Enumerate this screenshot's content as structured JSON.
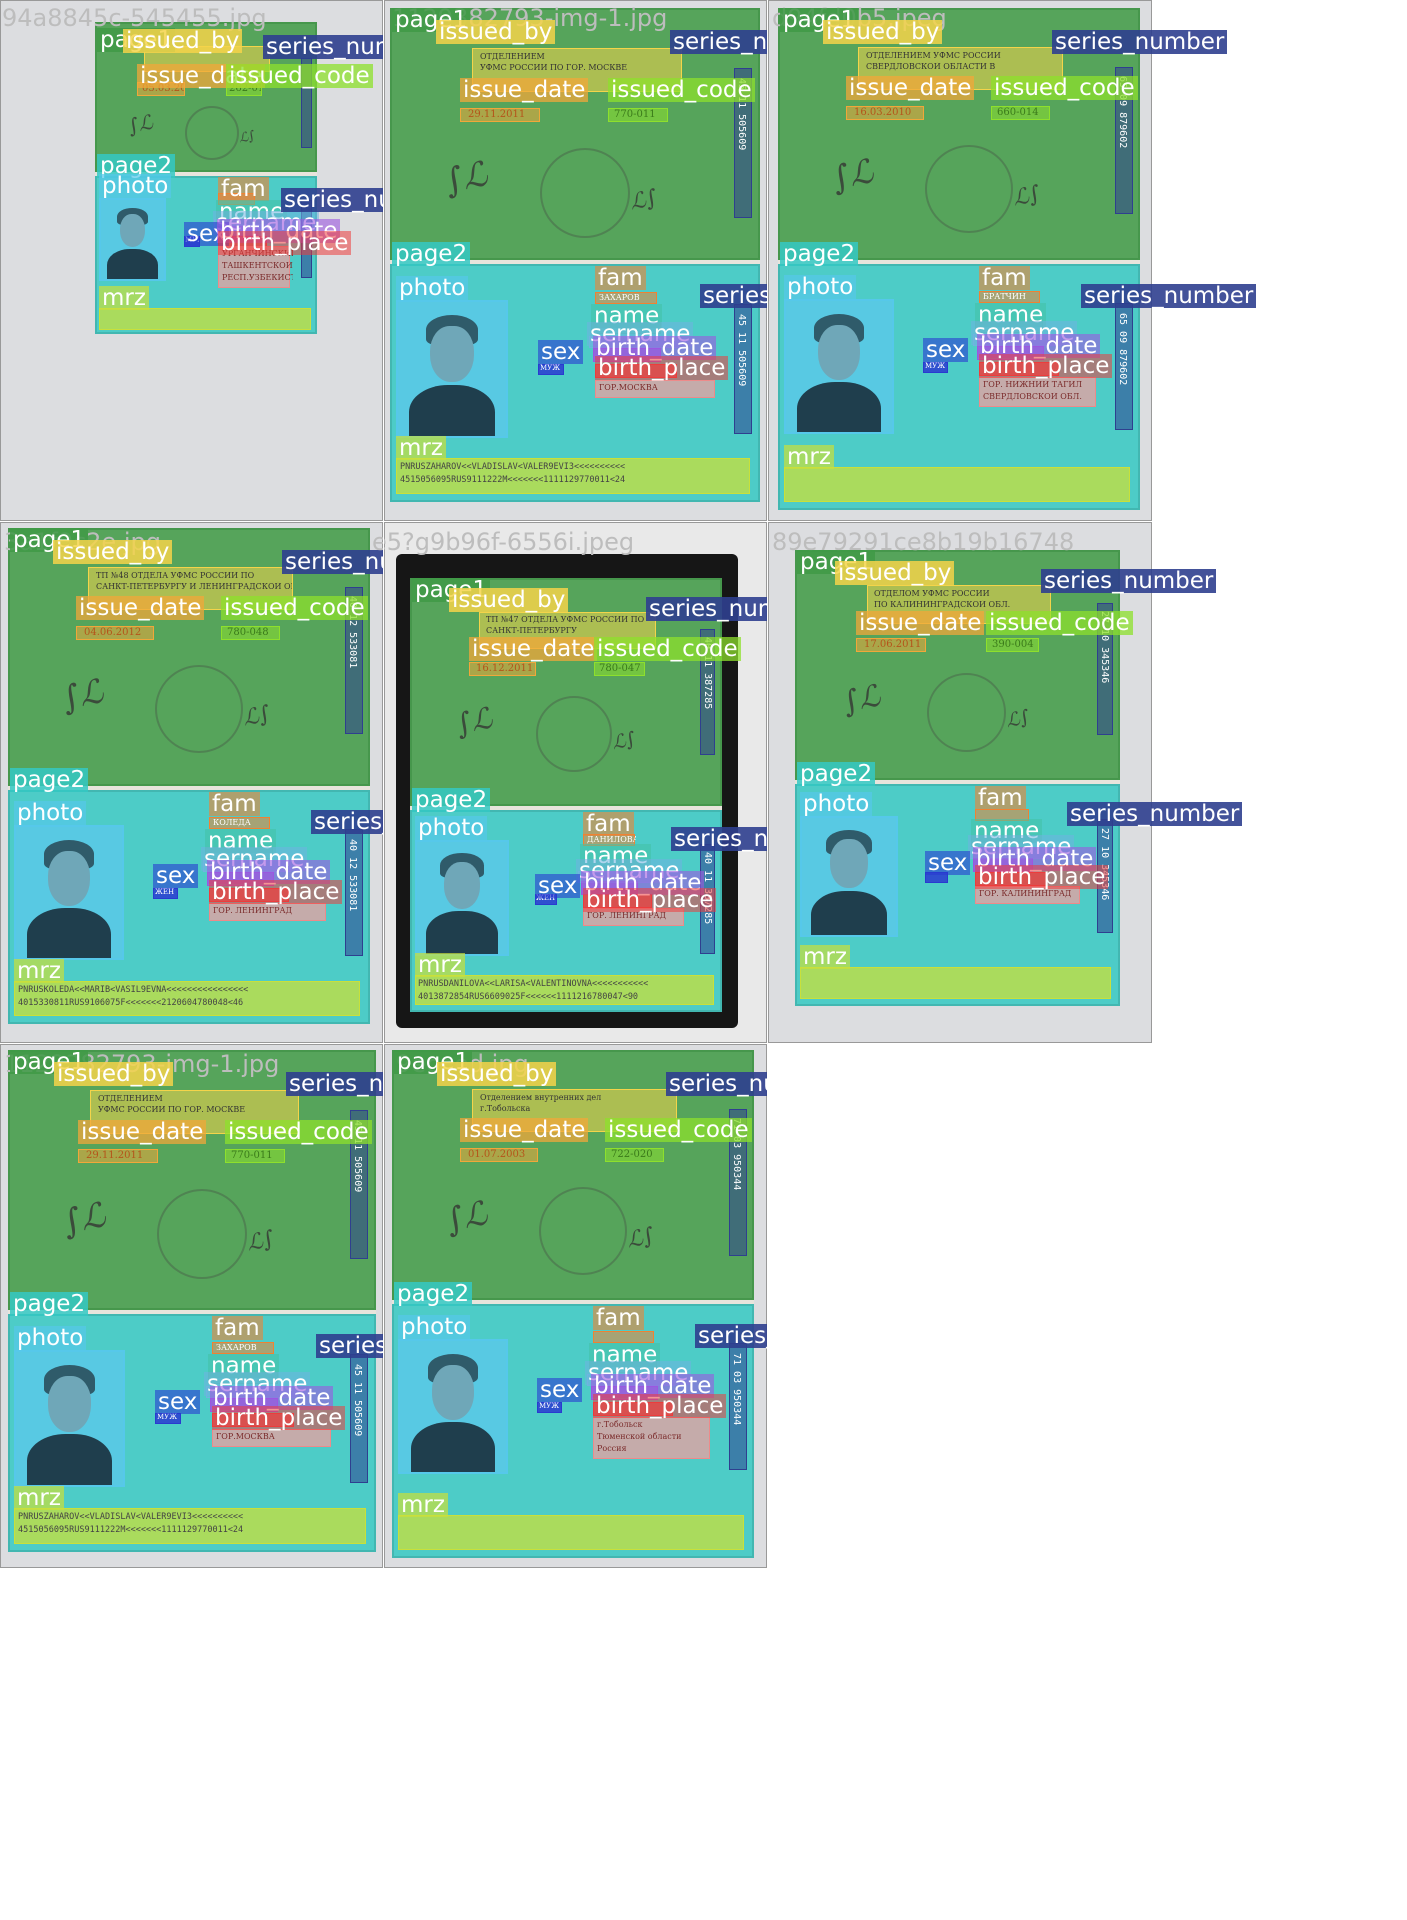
{
  "colors": {
    "page1": "#3f9a47",
    "page2": "#34c9c4",
    "issued_by": "#f4d44a",
    "issue_date": "#f1a73a",
    "issued_code": "#8ee02c",
    "series_number": "#2f3f8f",
    "photo": "#56c8ea",
    "fam": "#f08232",
    "name": "#45c1a6",
    "sername": "#6fb3e0",
    "birth_date": "#9c57e0",
    "birth_place": "#ee3d3d",
    "sex": "#2a3ad0",
    "mrz": "#c9e03a"
  },
  "labels": {
    "page1": "page1",
    "page2": "page2",
    "passport": "passport",
    "issued_by": "issued_by",
    "issue_date": "issue_date",
    "issued_code": "issued_code",
    "series_number": "series_number",
    "photo": "photo",
    "fam": "fam",
    "name": "name",
    "sername": "sername",
    "sex": "sex",
    "birth_date": "birth_date",
    "birth_place": "birth_place",
    "mrz": "mrz",
    "code": "code"
  },
  "cells": [
    {
      "filename": "94a8845c-545455.jpg",
      "issue_date": "05.03.2004",
      "issued_code": "262-015",
      "series_number": "",
      "sex": "МУЖ",
      "birth_place": [
        "УРГАНЧИНСКИЙ Р-Н",
        "ТАШКЕНТСКОЙ ОБЛ.",
        "РЕСП.УЗБЕКИСТАН"
      ],
      "mrz": [
        "",
        ""
      ]
    },
    {
      "filename": "1129382793-img-1.jpg",
      "issued_by": [
        "ОТДЕЛЕНИЕМ",
        "УФМС РОССИИ ПО ГОР. МОСКВЕ"
      ],
      "issue_date": "29.11.2011",
      "issued_code": "770-011",
      "series_number": "45 11 505609",
      "fam": "ЗАХАРОВ",
      "sex": "МУЖ",
      "birth_place": [
        "ГОР.МОСКВА"
      ],
      "mrz": [
        "PNRUSZAHAROV<<VLADISLAV<VALER9EVI3<<<<<<<<<<",
        "4515056095RUS9111222M<<<<<<<1111129770011<24"
      ]
    },
    {
      "filename": "d94fd0b5.jpeg",
      "issued_by": [
        "ОТДЕЛЕНИЕМ УФМС РОССИИ",
        "СВЕРДЛОВСКОЙ ОБЛАСТИ В"
      ],
      "issue_date": "16.03.2010",
      "issued_code": "660-014",
      "series_number": "65 09 879602",
      "fam": "БРАТЧИН",
      "sex": "МУЖ",
      "birth_place": [
        "ГОР. НИЖНИЙ ТАГИЛ",
        "СВЕРДЛОВСКОЙ ОБЛ."
      ],
      "mrz": [
        "",
        ""
      ]
    },
    {
      "filename": "3a1f9c2e.jpg",
      "issued_by": [
        "ТП №48 ОТДЕЛА УФМС РОССИИ ПО",
        "САНКТ-ПЕТЕРБУРГУ И ЛЕНИНГРАДСКОЙ ОБЛ."
      ],
      "issue_date": "04.06.2012",
      "issued_code": "780-048",
      "series_number": "40 12 533081",
      "fam": "КОЛЕДА",
      "sex": "ЖЕН",
      "birth_place": [
        "ГОР. ЛЕНИНГРАД"
      ],
      "mrz": [
        "PNRUSKOLEDA<<MARIB<VASIL9EVNA<<<<<<<<<<<<<<<<",
        "4015330811RUS9106075F<<<<<<<2120604780048<46"
      ]
    },
    {
      "filename": "e5?g9b96f-6556i.jpeg",
      "issued_by": [
        "ТП №47 ОТДЕЛА УФМС РОССИИ ПО",
        "САНКТ-ПЕТЕРБУРГУ"
      ],
      "issue_date": "16.12.2011",
      "issued_code": "780-047",
      "series_number": "40 11 387285",
      "fam": "ДАНИЛОВА",
      "sex": "ЖЕН",
      "birth_place": [
        "ГОР. ЛЕНИНГРАД"
      ],
      "mrz": [
        "PNRUSDANILOVA<<LARISA<VALENTINOVNA<<<<<<<<<<<",
        "4013872854RUS6609025F<<<<<<1111216780047<90"
      ]
    },
    {
      "filename": "89e79291ce8b19b16748",
      "issued_by": [
        "ОТДЕЛОМ УФМС РОССИИ",
        "ПО КАЛИНИНГРАДСКОЙ ОБЛ."
      ],
      "issue_date": "17.06.2011",
      "issued_code": "390-004",
      "series_number": "27 10 345346",
      "fam": "",
      "sex": "",
      "birth_place": [
        "ГОР. КАЛИНИНГРАД"
      ],
      "mrz": [
        "",
        ""
      ]
    },
    {
      "filename": "1129382793-img-1.jpg",
      "issued_by": [
        "ОТДЕЛЕНИЕМ",
        "УФМС РОССИИ ПО ГОР. МОСКВЕ"
      ],
      "issue_date": "29.11.2011",
      "issued_code": "770-011",
      "series_number": "45 11 505609",
      "fam": "ЗАХАРОВ",
      "sex": "МУЖ",
      "birth_place": [
        "ГОР.МОСКВА"
      ],
      "mrz": [
        "PNRUSZAHAROV<<VLADISLAV<VALER9EVI3<<<<<<<<<<",
        "4515056095RUS9111222M<<<<<<<1111129770011<24"
      ]
    },
    {
      "filename": "9ecaed.jpg",
      "issued_by": [
        "Отделением внутренних дел",
        "г.Тобольска"
      ],
      "issue_date": "01.07.2003",
      "issued_code": "722-020",
      "series_number": "71 03 950344",
      "fam": "",
      "sex": "МУЖ",
      "birth_place": [
        "г.Тобольск",
        "Тюменской области",
        "Россия"
      ],
      "mrz": [
        "",
        ""
      ]
    }
  ]
}
